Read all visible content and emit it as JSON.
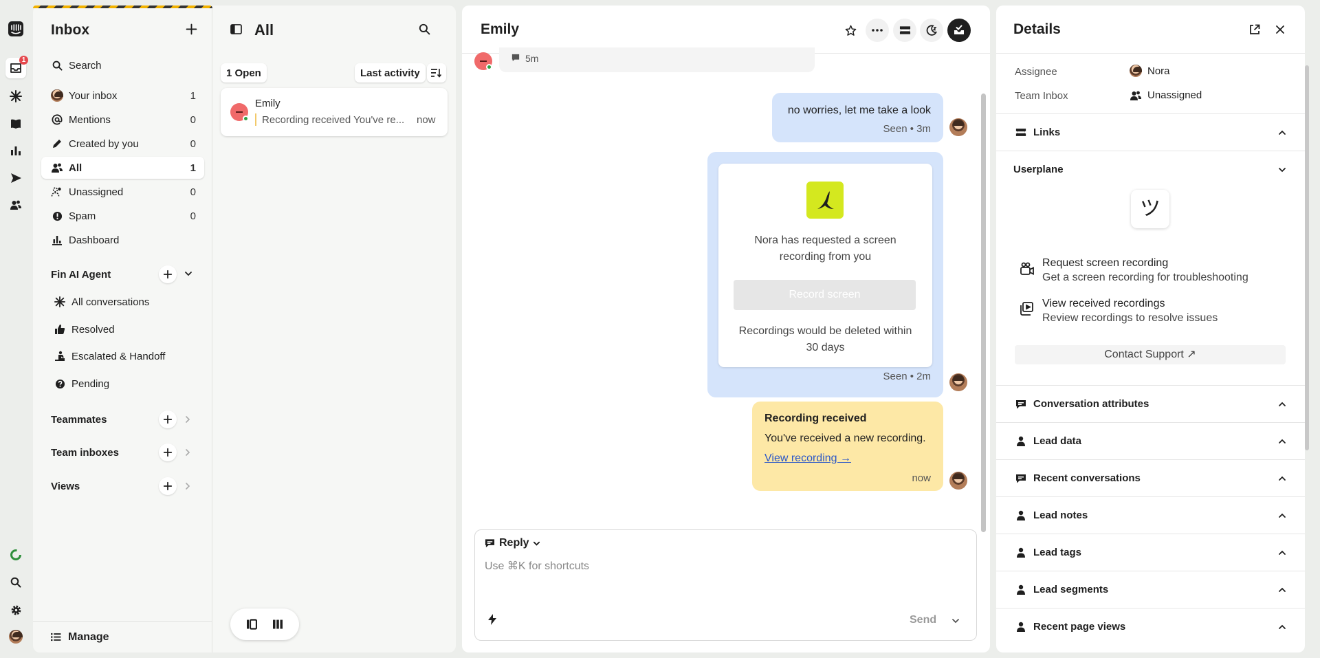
{
  "rail": {
    "inbox_badge": "1"
  },
  "sidebar": {
    "title": "Inbox",
    "search_label": "Search",
    "items": [
      {
        "label": "Your inbox",
        "count": "1"
      },
      {
        "label": "Mentions",
        "count": "0"
      },
      {
        "label": "Created by you",
        "count": "0"
      },
      {
        "label": "All",
        "count": "1"
      },
      {
        "label": "Unassigned",
        "count": "0"
      },
      {
        "label": "Spam",
        "count": "0"
      },
      {
        "label": "Dashboard",
        "count": ""
      }
    ],
    "fin_section": {
      "title": "Fin AI Agent",
      "items": [
        {
          "label": "All conversations"
        },
        {
          "label": "Resolved"
        },
        {
          "label": "Escalated & Handoff"
        },
        {
          "label": "Pending"
        }
      ]
    },
    "sections": [
      {
        "title": "Teammates"
      },
      {
        "title": "Team inboxes"
      },
      {
        "title": "Views"
      }
    ],
    "manage_label": "Manage"
  },
  "list": {
    "title": "All",
    "open_label": "1 Open",
    "sort_label": "Last activity",
    "conversation": {
      "name": "Emily",
      "preview": "Recording received You've re...",
      "time": "now"
    }
  },
  "main": {
    "title": "Emily",
    "note_time": "5m",
    "messages": [
      {
        "text": "no worries, let me take a look",
        "status": "Seen • 3m"
      }
    ],
    "recording_request": {
      "text": "Nora has requested a screen recording from you",
      "button": "Record screen",
      "footer": "Recordings would be deleted within 30 days",
      "status": "Seen • 2m"
    },
    "received": {
      "title": "Recording received",
      "text": "You've received a new recording.",
      "link": "View recording →",
      "time": "now"
    },
    "composer": {
      "mode": "Reply",
      "placeholder": "Use ⌘K for shortcuts",
      "send_label": "Send"
    }
  },
  "details": {
    "title": "Details",
    "assignee_label": "Assignee",
    "assignee_value": "Nora",
    "team_label": "Team Inbox",
    "team_value": "Unassigned",
    "links_label": "Links",
    "userplane": {
      "title": "Userplane",
      "logo_glyph": "ツ",
      "actions": [
        {
          "title": "Request screen recording",
          "desc": "Get a screen recording for troubleshooting"
        },
        {
          "title": "View received recordings",
          "desc": "Review recordings to resolve issues"
        }
      ],
      "contact_label": "Contact Support ↗"
    },
    "sections": [
      {
        "label": "Conversation attributes"
      },
      {
        "label": "Lead data"
      },
      {
        "label": "Recent conversations"
      },
      {
        "label": "Lead notes"
      },
      {
        "label": "Lead tags"
      },
      {
        "label": "Lead segments"
      },
      {
        "label": "Recent page views"
      }
    ]
  },
  "colors": {
    "accent_blue": "#d5e4fb",
    "received_yellow": "#fde8a6",
    "userplane_logo": "#d4e81f",
    "status_red": "#f06a6a"
  }
}
